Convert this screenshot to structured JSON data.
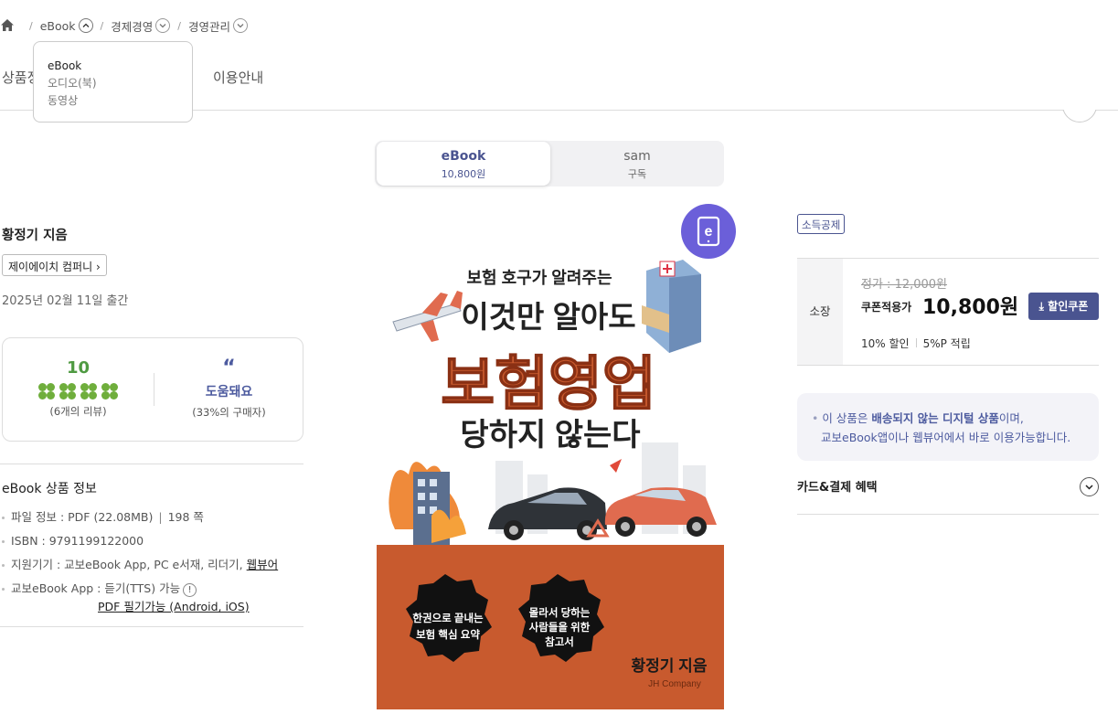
{
  "breadcrumb": {
    "items": [
      "eBook",
      "경제경영",
      "경영관리"
    ]
  },
  "dropdown": {
    "options": [
      "eBook",
      "오디오(북)",
      "동영상"
    ]
  },
  "tabs": {
    "first_partial": "상품정",
    "usage": "이용안내"
  },
  "format_switch": {
    "ebook_label": "eBook",
    "ebook_price": "10,800원",
    "sam_label": "sam",
    "sam_sub": "구독"
  },
  "book": {
    "author": "황정기 지음",
    "publisher": "제이에이치 컴퍼니",
    "pub_date": "2025년 02월 11일 출간"
  },
  "review": {
    "score": "10",
    "review_count": "(6개의 리뷰)",
    "help_label": "도움돼요",
    "help_sub": "(33%의 구매자)"
  },
  "ebook_info": {
    "title": "eBook 상품 정보",
    "file_info": "파일 정보 : PDF (22.08MB)",
    "pages": "198 쪽",
    "isbn": "ISBN : 9791199122000",
    "devices": "지원기기 : 교보eBook App, PC e서재, 리더기,",
    "webviewer": "웹뷰어",
    "app": "교보eBook App : 듣기(TTS) 가능",
    "pdf_note": "PDF 필기가능 (Android, iOS)"
  },
  "cover": {
    "subtitle": "보험 호구가 알려주는",
    "line1": "이것만 알아도",
    "main": "보험영업",
    "line3": "당하지 않는다",
    "badge1_l1": "한권으로 끝내는",
    "badge1_l2": "보험 핵심 요약",
    "badge2_l1": "몰라서 당하는",
    "badge2_l2": "사람들을 위한",
    "badge2_l3": "참고서",
    "author": "황정기 지음",
    "publisher": "JH Company",
    "badge_letter": "e"
  },
  "pricing": {
    "tag": "소득공제",
    "row_label": "소장",
    "original": "정가 : 12,000원",
    "coupon_label": "쿠폰적용가",
    "coupon_price": "10,800원",
    "coupon_button": "할인쿠폰",
    "discount": "10% 할인",
    "points": "5%P 적립"
  },
  "notice": {
    "prefix": "이 상품은 ",
    "bold": "배송되지 않는 디지털 상품",
    "suffix": "이며,",
    "line2": "교보eBook앱이나 웹뷰어에서 바로 이용가능합니다."
  },
  "card_benefit": "카드&결제 혜택",
  "colors": {
    "accent": "#4a5490",
    "green": "#4f9a42",
    "cover_orange": "#c85a2e",
    "ebadge": "#6b5fd9"
  }
}
